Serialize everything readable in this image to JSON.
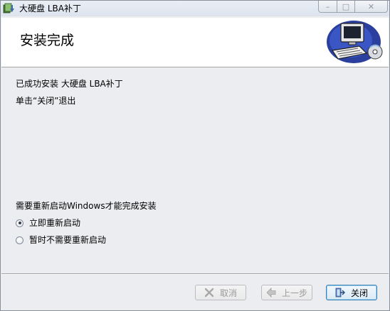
{
  "window": {
    "title": "大硬盘 LBA补丁",
    "min_label": "–",
    "max_label": "□",
    "close_label": "✕"
  },
  "banner": {
    "title": "安装完成"
  },
  "body": {
    "line1": "已成功安装 大硬盘 LBA补丁",
    "line2": "单击“关闭”退出",
    "restart_prompt": "需要重新启动Windows才能完成安装",
    "options": [
      {
        "label": "立即重新启动",
        "selected": true
      },
      {
        "label": "暂时不需要重新启动",
        "selected": false
      }
    ]
  },
  "buttons": {
    "cancel": {
      "label": "取消",
      "enabled": false
    },
    "back": {
      "label": "上一步",
      "enabled": false
    },
    "close": {
      "label": "关闭",
      "enabled": true
    }
  },
  "icons": {
    "app": "installer-icon",
    "banner": "computer-cd-icon",
    "cancel": "x-icon",
    "back": "back-arrow-icon",
    "close": "exit-door-icon"
  }
}
